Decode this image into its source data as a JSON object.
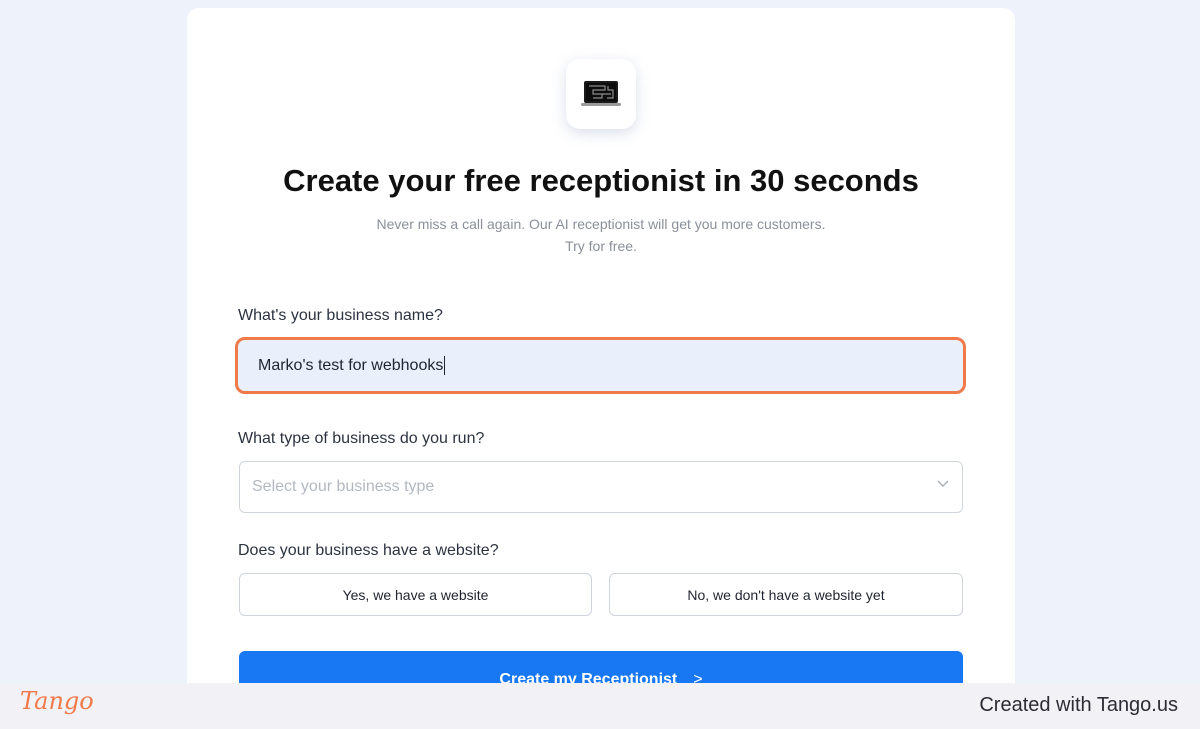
{
  "header": {
    "title": "Create your free receptionist in 30 seconds",
    "subtitle_line1": "Never miss a call again. Our AI receptionist will get you more customers.",
    "subtitle_line2": "Try for free."
  },
  "logo": {
    "icon": "laptop-icon"
  },
  "form": {
    "business_name_label": "What's your business name?",
    "business_name_value": "Marko's test for webhooks",
    "business_type_label": "What type of business do you run?",
    "business_type_placeholder": "Select your business type",
    "website_label": "Does your business have a website?",
    "website_yes": "Yes, we have a website",
    "website_no": "No, we don't have a website yet",
    "submit_label": "Create my Receptionist",
    "submit_arrow": ">"
  },
  "footer": {
    "brand": "Tango",
    "created_with": "Created with Tango.us"
  },
  "colors": {
    "accent_blue": "#1877f2",
    "highlight_orange": "#f07a4a",
    "page_background": "#eef3fb"
  }
}
